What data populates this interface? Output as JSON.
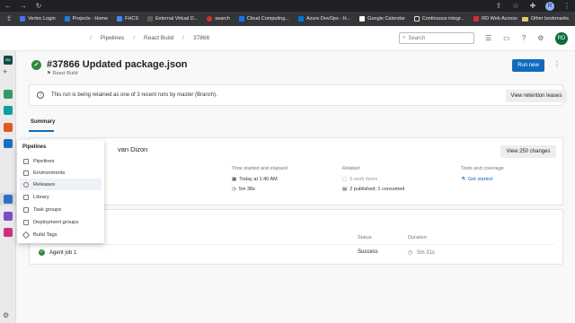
{
  "browser": {
    "profile_initial": "R",
    "bookmarks": [
      {
        "label": "Vertec Login",
        "color": "#4c6ef5"
      },
      {
        "label": "Projects - Home",
        "color": "#1f7ae0"
      },
      {
        "label": "FHCS",
        "color": "#4285f4"
      },
      {
        "label": "External Virtual D...",
        "color": "#5a5a5a"
      },
      {
        "label": "search",
        "color": "#d93025"
      },
      {
        "label": "Cloud Computing...",
        "color": "#1a73e8"
      },
      {
        "label": "Azure DevOps - H...",
        "color": "#0078d4"
      },
      {
        "label": "Google Calendar",
        "color": "#ffffff"
      },
      {
        "label": "Continuous integr...",
        "color": "#333333"
      },
      {
        "label": "RD Web Access",
        "color": "#d32f2f"
      }
    ],
    "other_bookmarks": "Other bookmarks"
  },
  "header": {
    "breadcrumbs": [
      "Pipelines",
      "React Build",
      "37866"
    ],
    "search_placeholder": "Search",
    "user_initials": "RD"
  },
  "rail": {
    "org_badge": "BA"
  },
  "run": {
    "title": "#37866 Updated package.json",
    "pipeline": "React Build",
    "run_new_label": "Run new",
    "more_label": "⋮"
  },
  "banner": {
    "info_glyph": "i",
    "text": "This run is being retained as one of 3 recent runs by master (Branch).",
    "button": "View retention leases"
  },
  "tabs": {
    "summary": "Summary"
  },
  "summary": {
    "triggered_by": "van Dizon",
    "view_changes": "View 250 changes",
    "time": {
      "header": "Time started and elapsed",
      "started": "Today at 1:40 AM",
      "elapsed": "5m 38s"
    },
    "related": {
      "header": "Related",
      "work_items": "0 work items",
      "artifacts": "2 published; 1 consumed"
    },
    "tests": {
      "header": "Tests and coverage",
      "link": "Get started"
    }
  },
  "jobs": {
    "status_header": "Status",
    "duration_header": "Duration",
    "rows": [
      {
        "name": "Agent job 1",
        "status": "Success",
        "duration": "5m 31s"
      }
    ]
  },
  "flyout": {
    "title": "Pipelines",
    "items": [
      {
        "label": "Pipelines",
        "icon": "pipelines-icon"
      },
      {
        "label": "Environments",
        "icon": "environments-icon"
      },
      {
        "label": "Releases",
        "icon": "releases-icon"
      },
      {
        "label": "Library",
        "icon": "library-icon"
      },
      {
        "label": "Task groups",
        "icon": "task-groups-icon"
      },
      {
        "label": "Deployment groups",
        "icon": "deployment-groups-icon"
      },
      {
        "label": "Build Tags",
        "icon": "tag-icon"
      }
    ]
  }
}
